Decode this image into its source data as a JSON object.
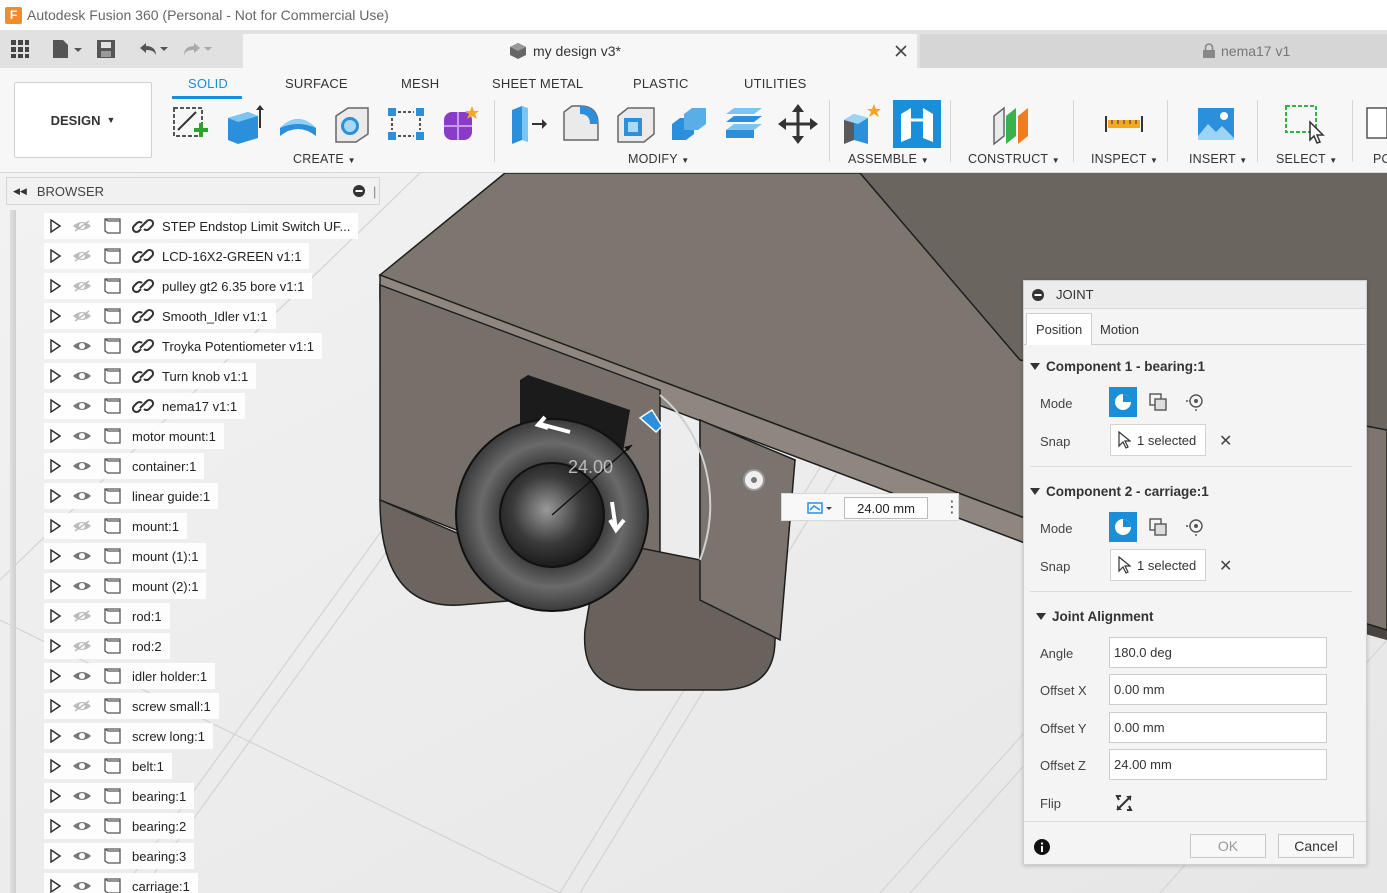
{
  "window": {
    "title": "Autodesk Fusion 360 (Personal - Not for Commercial Use)",
    "app_icon": "F"
  },
  "tabs": [
    {
      "label": "my design v3*"
    },
    {
      "label": "nema17 v1"
    }
  ],
  "workspace": {
    "label": "DESIGN"
  },
  "ribbon_tabs": [
    "SOLID",
    "SURFACE",
    "MESH",
    "SHEET METAL",
    "PLASTIC",
    "UTILITIES"
  ],
  "groups": {
    "create": "CREATE",
    "modify": "MODIFY",
    "assemble": "ASSEMBLE",
    "construct": "CONSTRUCT",
    "inspect": "INSPECT",
    "insert": "INSERT",
    "select": "SELECT",
    "position_partial": "PO"
  },
  "browser": {
    "title": "BROWSER",
    "items": [
      {
        "label": "STEP Endstop Limit Switch UF...",
        "visible": false,
        "linked": true
      },
      {
        "label": "LCD-16X2-GREEN v1:1",
        "visible": false,
        "linked": true
      },
      {
        "label": "pulley gt2 6.35 bore v1:1",
        "visible": false,
        "linked": true
      },
      {
        "label": "Smooth_Idler v1:1",
        "visible": false,
        "linked": true
      },
      {
        "label": "Troyka Potentiometer v1:1",
        "visible": true,
        "linked": true
      },
      {
        "label": "Turn knob v1:1",
        "visible": true,
        "linked": true
      },
      {
        "label": "nema17 v1:1",
        "visible": true,
        "linked": true
      },
      {
        "label": "motor mount:1",
        "visible": true,
        "linked": false
      },
      {
        "label": "container:1",
        "visible": true,
        "linked": false
      },
      {
        "label": "linear guide:1",
        "visible": true,
        "linked": false
      },
      {
        "label": "mount:1",
        "visible": false,
        "linked": false
      },
      {
        "label": "mount (1):1",
        "visible": true,
        "linked": false
      },
      {
        "label": "mount (2):1",
        "visible": true,
        "linked": false
      },
      {
        "label": "rod:1",
        "visible": false,
        "linked": false
      },
      {
        "label": "rod:2",
        "visible": false,
        "linked": false
      },
      {
        "label": "idler holder:1",
        "visible": true,
        "linked": false
      },
      {
        "label": "screw small:1",
        "visible": false,
        "linked": false
      },
      {
        "label": "screw long:1",
        "visible": true,
        "linked": false
      },
      {
        "label": "belt:1",
        "visible": true,
        "linked": false
      },
      {
        "label": "bearing:1",
        "visible": true,
        "linked": false
      },
      {
        "label": "bearing:2",
        "visible": true,
        "linked": false
      },
      {
        "label": "bearing:3",
        "visible": true,
        "linked": false
      },
      {
        "label": "carriage:1",
        "visible": true,
        "linked": false
      }
    ]
  },
  "viewport": {
    "dimension_label": "24.00",
    "dimension_input": "24.00 mm"
  },
  "joint": {
    "title": "JOINT",
    "tabs": [
      "Position",
      "Motion"
    ],
    "component1": {
      "title": "Component 1 - bearing:1",
      "mode_label": "Mode",
      "snap_label": "Snap",
      "snap_value": "1 selected"
    },
    "component2": {
      "title": "Component 2 - carriage:1",
      "mode_label": "Mode",
      "snap_label": "Snap",
      "snap_value": "1 selected"
    },
    "alignment": {
      "title": "Joint Alignment",
      "angle_label": "Angle",
      "angle_value": "180.0 deg",
      "offset_x_label": "Offset X",
      "offset_x_value": "0.00 mm",
      "offset_y_label": "Offset Y",
      "offset_y_value": "0.00 mm",
      "offset_z_label": "Offset Z",
      "offset_z_value": "24.00 mm",
      "flip_label": "Flip"
    },
    "ok_label": "OK",
    "cancel_label": "Cancel"
  },
  "colors": {
    "accent": "#1a8fd9",
    "model": "#7a746d",
    "logo": "#f28c28"
  }
}
